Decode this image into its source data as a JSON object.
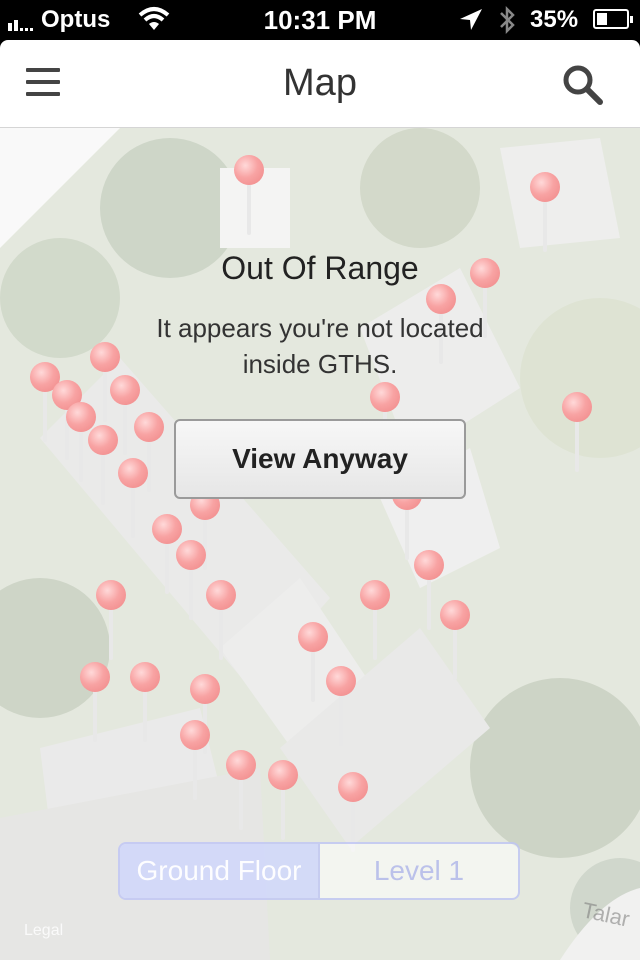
{
  "status_bar": {
    "carrier": "Optus",
    "time": "10:31 PM",
    "battery": "35%"
  },
  "nav": {
    "title": "Map",
    "menu_icon": "menu-icon",
    "search_icon": "search-icon"
  },
  "overlay": {
    "title": "Out Of Range",
    "message": "It appears you're not located inside GTHS.",
    "button_label": "View Anyway"
  },
  "floor_selector": {
    "options": [
      "Ground Floor",
      "Level 1"
    ],
    "selected": "Ground Floor"
  },
  "map": {
    "legal": "Legal",
    "street_label": "Talar"
  },
  "colors": {
    "pin": "#f29a9a",
    "segment_tint": "#a8b0f0"
  }
}
